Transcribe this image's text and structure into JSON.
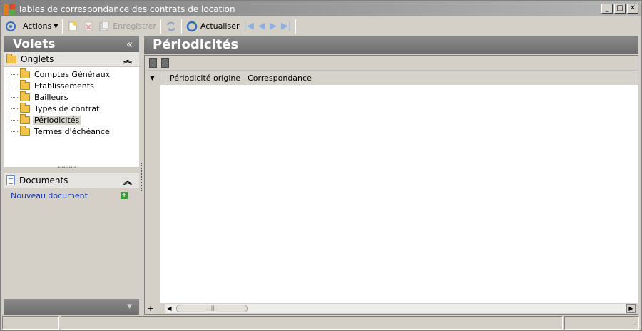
{
  "window": {
    "title": "Tables de correspondance des contrats de location",
    "buttons": [
      "_",
      "□",
      "✕"
    ]
  },
  "toolbar": {
    "actions_label": "Actions",
    "save_label": "Enregistrer",
    "refresh_label": "Actualiser"
  },
  "left_pane": {
    "title": "Volets",
    "collapse_glyph": "«",
    "onglets": {
      "header": "Onglets",
      "items": [
        {
          "label": "Comptes Généraux"
        },
        {
          "label": "Etablissements"
        },
        {
          "label": "Bailleurs"
        },
        {
          "label": "Types de contrat"
        },
        {
          "label": "Périodicités",
          "selected": true
        },
        {
          "label": "Termes d'échéance"
        }
      ]
    },
    "documents": {
      "header": "Documents",
      "new_document": "Nouveau document"
    }
  },
  "main": {
    "title": "Périodicités",
    "grid": {
      "columns": [
        "Périodicité origine",
        "Correspondance"
      ],
      "rows": []
    }
  }
}
